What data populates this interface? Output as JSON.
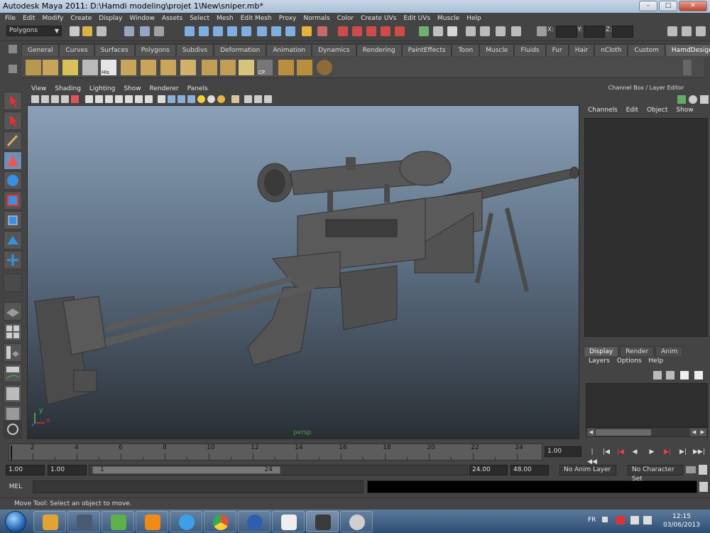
{
  "window": {
    "title": "Autodesk Maya 2011: D:\\Hamdi modeling\\projet 1\\New\\sniper.mb*",
    "minimize_label": "–",
    "maximize_label": "□",
    "close_label": "✕"
  },
  "menubar": [
    "File",
    "Edit",
    "Modify",
    "Create",
    "Display",
    "Window",
    "Assets",
    "Select",
    "Mesh",
    "Edit Mesh",
    "Proxy",
    "Normals",
    "Color",
    "Create UVs",
    "Edit UVs",
    "Muscle",
    "Help"
  ],
  "statusline": {
    "mode": "Polygons",
    "x_label": "X:",
    "y_label": "Y:",
    "z_label": "Z:"
  },
  "shelf": {
    "tabs": [
      "General",
      "Curves",
      "Surfaces",
      "Polygons",
      "Subdivs",
      "Deformation",
      "Animation",
      "Dynamics",
      "Rendering",
      "PaintEffects",
      "Toon",
      "Muscle",
      "Fluids",
      "Fur",
      "Hair",
      "nCloth",
      "Custom",
      "HamdDesigners"
    ],
    "active_tab": "HamdDesigners",
    "icon_labels": {
      "his": "His",
      "cp": "CP"
    }
  },
  "panel": {
    "menu": [
      "View",
      "Shading",
      "Lighting",
      "Show",
      "Renderer",
      "Panels"
    ],
    "camera": "persp",
    "axis_x": "x",
    "axis_y": "y"
  },
  "channel_box": {
    "title": "Channel Box / Layer Editor",
    "menu": [
      "Channels",
      "Edit",
      "Object",
      "Show"
    ]
  },
  "layer_editor": {
    "tabs": [
      "Display",
      "Render",
      "Anim"
    ],
    "active_tab": "Display",
    "menu": [
      "Layers",
      "Options",
      "Help"
    ]
  },
  "timeline": {
    "ticks": [
      "2",
      "4",
      "6",
      "8",
      "10",
      "12",
      "14",
      "16",
      "18",
      "20",
      "22",
      "24"
    ],
    "current_frame": "1.00",
    "range_start": "1.00",
    "playback_start": "1.00",
    "range_thumb_start": "1",
    "range_thumb_end": "24",
    "playback_end": "24.00",
    "range_end": "48.00",
    "anim_layer": "No Anim Layer",
    "character_set": "No Character Set"
  },
  "command_line": {
    "label": "MEL"
  },
  "help_line": "Move Tool: Select an object to move.",
  "taskbar": {
    "language": "FR",
    "time": "12:15",
    "date": "03/06/2013"
  },
  "colors": {
    "ui_bg": "#444444",
    "viewport_top": "#8aa0b6",
    "viewport_bottom": "#2a2f35",
    "active_tool": "#6f8fb4",
    "model": "#565656"
  }
}
